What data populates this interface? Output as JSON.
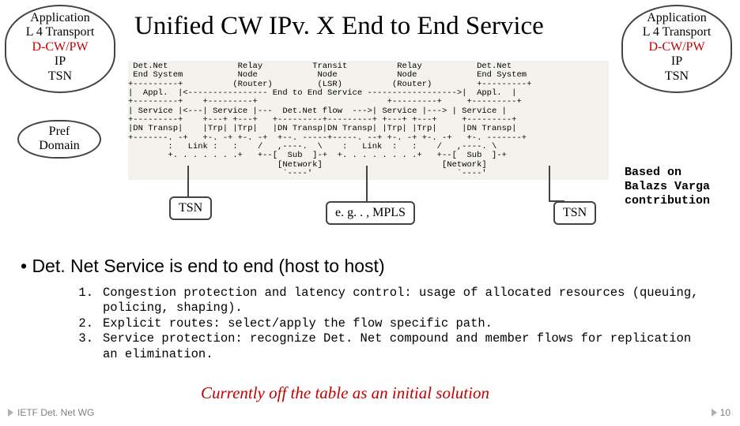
{
  "title": "Unified CW IPv. X End to End Service",
  "stack": {
    "line1": "Application",
    "line2": "L 4 Transport",
    "line3": "D-CW/PW",
    "line4": "IP",
    "line5": "TSN"
  },
  "pref": {
    "line1": "Pref",
    "line2": "Domain"
  },
  "ascii": " Det.Net              Relay          Transit          Relay           Det.Net\n End System           Node            Node            Node            End System\n+---------+          (Router)         (LSR)          (Router)         +---------+\n|  Appl.  |<---------------- End to End Service ------------------>|  Appl.  |\n+---------+    +---------+                          +---------+     +---------+\n| Service |<---| Service |---  Det.Net flow  --->| Service |---> | Service |\n+---------+    +---+ +---+   +---------+---------+ +---+ +---+     +---------+\n|DN Transp|    |Trp| |Trp|   |DN Transp|DN Transp| |Trp| |Trp|     |DN Transp|\n+-------. -+   +-. -+ +-. -+  +--. -----+-----. --+ +-. -+ +-. -+   +-. -------+\n        :   Link :   :    /   ,----.  \\    :   Link  :   :    /   ,----. \\\n        +. . . . . . .+   +--[  Sub  ]-+  +. . . . . . . .+   +--[  Sub  ]-+\n                              [Network]                        [Network]\n                               `----'                             `----'",
  "callouts": {
    "tsn1": "TSN",
    "mid": "e. g. . , MPLS",
    "tsn2": "TSN"
  },
  "credit": {
    "l1": "Based on",
    "l2": "Balazs Varga",
    "l3": "contribution"
  },
  "bullet1": "• Det. Net Service is end to end (host to host)",
  "list": {
    "i1n": "1.",
    "i1": "Congestion protection and latency control: usage of allocated resources (queuing, policing, shaping).",
    "i2n": "2.",
    "i2": "Explicit routes: select/apply the flow specific path.",
    "i3n": "3.",
    "i3": "Service protection: recognize Det. Net compound and member flows for replication an elimination."
  },
  "note": "Currently off the table as an initial solution",
  "footer": {
    "left": "IETF Det. Net WG",
    "page": "10"
  }
}
